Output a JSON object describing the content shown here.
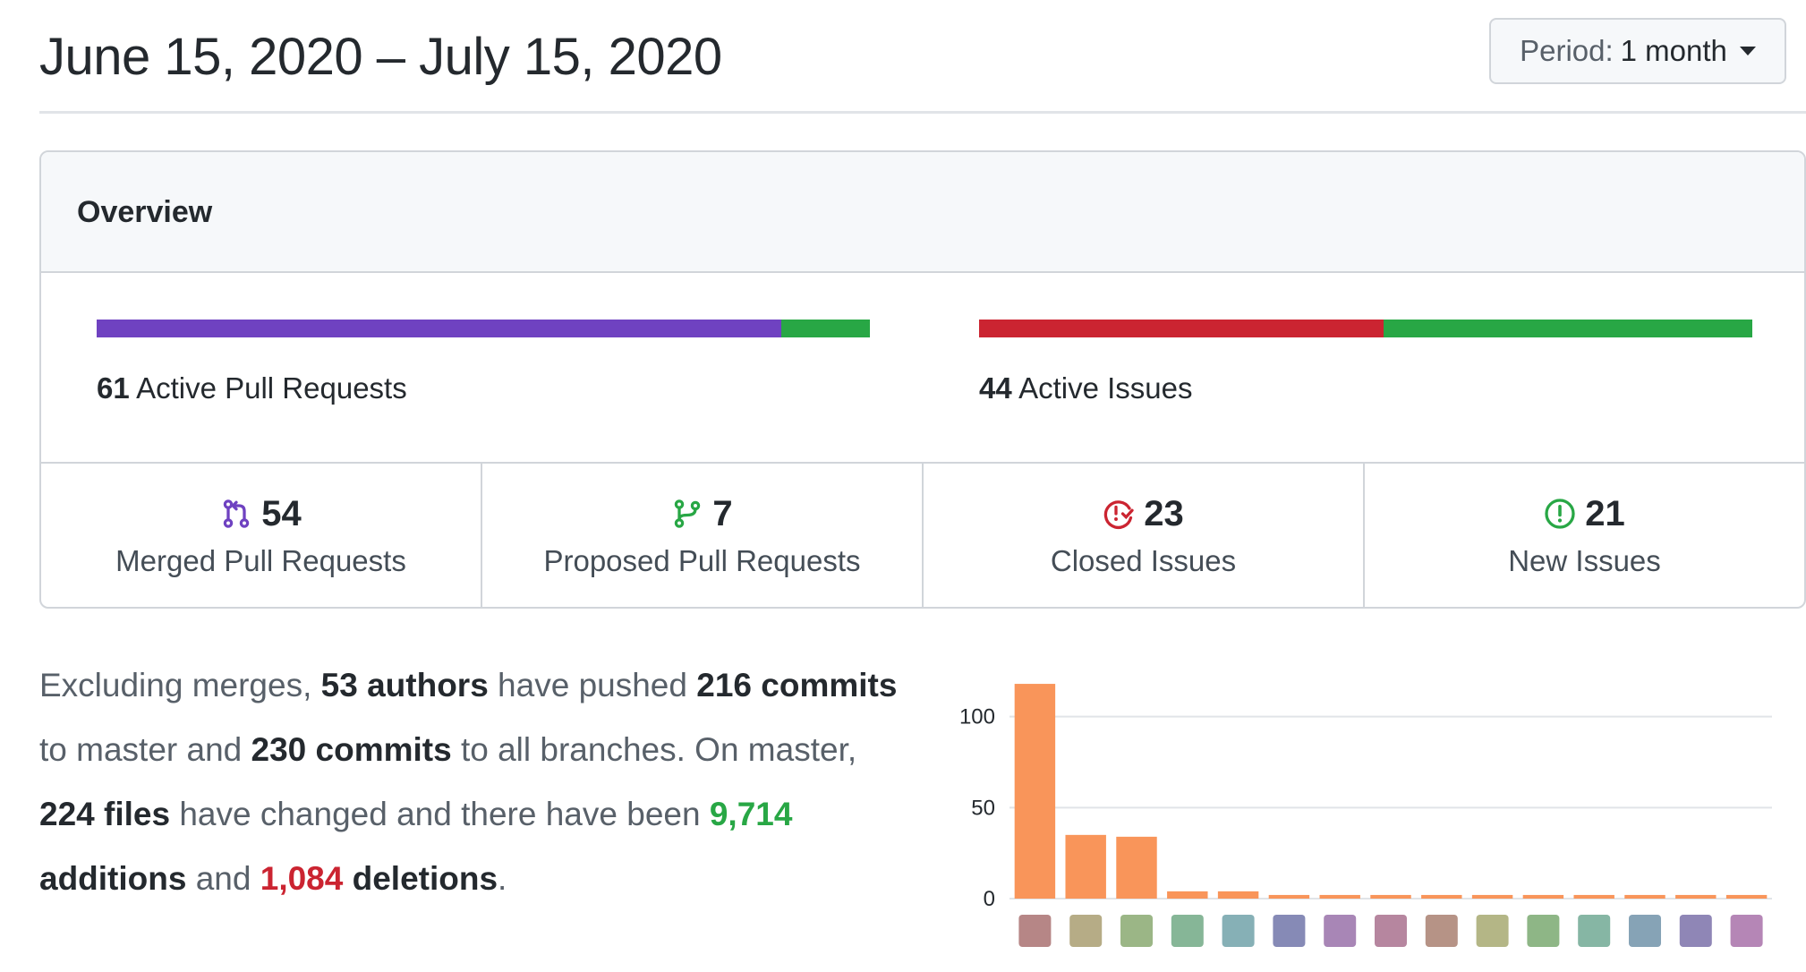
{
  "header": {
    "date_range": "June 15, 2020 – July 15, 2020",
    "period_label": "Period:",
    "period_value": "1 month"
  },
  "overview": {
    "title": "Overview",
    "pull_requests": {
      "count": "61",
      "label": "Active Pull Requests",
      "merged_share": 0.885,
      "colors": {
        "merged": "#6f42c1",
        "open": "#28a745"
      }
    },
    "issues": {
      "count": "44",
      "label": "Active Issues",
      "closed_share": 0.523,
      "colors": {
        "closed": "#cb2431",
        "open": "#28a745"
      }
    },
    "stats": [
      {
        "value": "54",
        "label": "Merged Pull Requests",
        "icon": "merged-pr-icon",
        "color": "#6f42c1"
      },
      {
        "value": "7",
        "label": "Proposed Pull Requests",
        "icon": "branch-icon",
        "color": "#28a745"
      },
      {
        "value": "23",
        "label": "Closed Issues",
        "icon": "closed-issue-icon",
        "color": "#cb2431"
      },
      {
        "value": "21",
        "label": "New Issues",
        "icon": "issue-opened-icon",
        "color": "#28a745"
      }
    ]
  },
  "summary": {
    "t1": "Excluding merges, ",
    "authors": "53 authors",
    "t2": " have pushed ",
    "master_commits": "216 commits",
    "t3": " to master and ",
    "all_commits": "230 commits",
    "t4": " to all branches. On master, ",
    "files": "224 files",
    "t5": " have changed and there have been ",
    "additions_num": "9,714",
    "additions_word": " additions",
    "t6": " and ",
    "deletions_num": "1,084",
    "deletions_word": " deletions",
    "t7": "."
  },
  "chart_data": {
    "type": "bar",
    "categories": [
      "author-1",
      "author-2",
      "author-3",
      "author-4",
      "author-5",
      "author-6",
      "author-7",
      "author-8",
      "author-9",
      "author-10",
      "author-11",
      "author-12",
      "author-13",
      "author-14",
      "author-15"
    ],
    "values": [
      118,
      35,
      34,
      4,
      4,
      2,
      2,
      2,
      2,
      2,
      2,
      2,
      2,
      2,
      2
    ],
    "ylim": [
      0,
      120
    ],
    "yticks": [
      "0",
      "50",
      "100"
    ],
    "bar_color": "#f9955a",
    "grid": true,
    "x_tick_labels": "avatar images"
  }
}
